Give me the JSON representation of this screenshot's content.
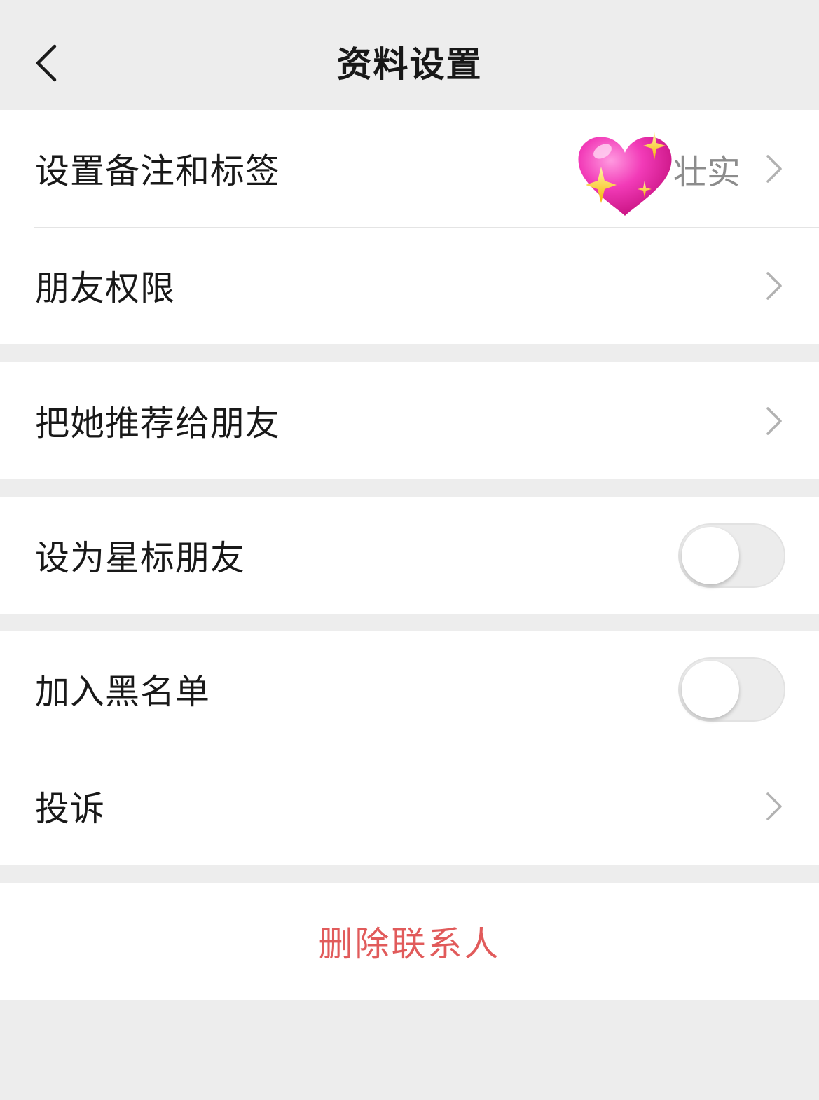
{
  "header": {
    "title": "资料设置",
    "back_icon": "chevron-left-icon"
  },
  "groups": [
    {
      "rows": [
        {
          "label": "设置备注和标签",
          "value": "壮实",
          "decoration": "sparkling-heart-emoji"
        },
        {
          "label": "朋友权限"
        }
      ]
    },
    {
      "rows": [
        {
          "label": "把她推荐给朋友"
        }
      ]
    },
    {
      "rows": [
        {
          "label": "设为星标朋友",
          "switch_on": false
        }
      ]
    },
    {
      "rows": [
        {
          "label": "加入黑名单",
          "switch_on": false
        },
        {
          "label": "投诉"
        }
      ]
    }
  ],
  "delete_contact": {
    "label": "删除联系人",
    "color": "#e15b5b"
  }
}
